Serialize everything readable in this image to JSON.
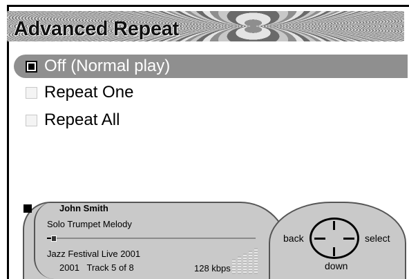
{
  "header": {
    "title": "Advanced Repeat"
  },
  "menu": {
    "items": [
      {
        "label": "Off (Normal play)",
        "checked": true,
        "selected": true
      },
      {
        "label": "Repeat One",
        "checked": false,
        "selected": false
      },
      {
        "label": "Repeat All",
        "checked": false,
        "selected": false
      }
    ]
  },
  "now_playing": {
    "artist": "John Smith",
    "track": "Solo Trumpet Melody",
    "album": "Jazz Festival Live 2001",
    "track_info": "2001   Track 5 of 8",
    "bitrate": "128 kbps",
    "progress_fraction": 0.03
  },
  "controls": {
    "back_label": "back",
    "select_label": "select",
    "down_label": "down"
  }
}
